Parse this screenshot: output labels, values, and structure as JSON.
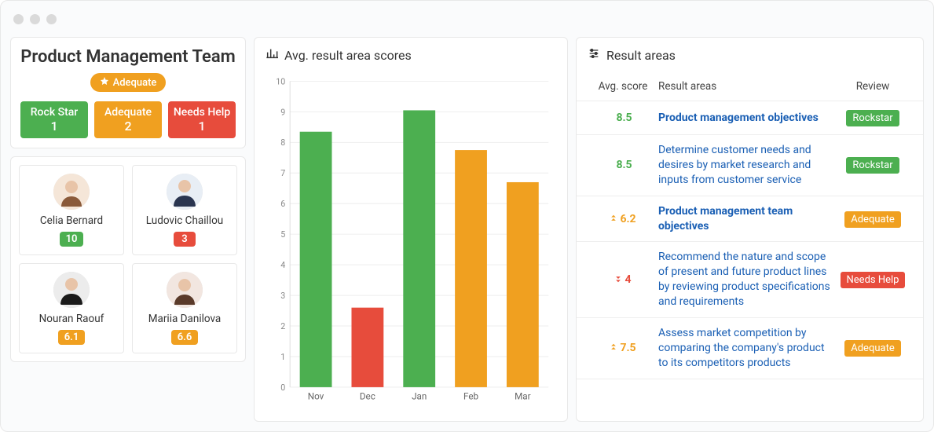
{
  "team": {
    "title": "Product Management Team",
    "badge_label": "Adequate",
    "badge_color": "#f0a020",
    "statuses": [
      {
        "label": "Rock Star",
        "count": "1",
        "color": "#4caf50"
      },
      {
        "label": "Adequate",
        "count": "2",
        "color": "#f0a020"
      },
      {
        "label": "Needs Help",
        "count": "1",
        "color": "#e74c3c"
      }
    ],
    "members": [
      {
        "name": "Celia Bernard",
        "score": "10",
        "score_color": "#4caf50"
      },
      {
        "name": "Ludovic Chaillou",
        "score": "3",
        "score_color": "#e74c3c"
      },
      {
        "name": "Nouran Raouf",
        "score": "6.1",
        "score_color": "#f0a020"
      },
      {
        "name": "Mariia Danilova",
        "score": "6.6",
        "score_color": "#f0a020"
      }
    ]
  },
  "chart_title": "Avg. result area scores",
  "chart_data": {
    "type": "bar",
    "title": "Avg. result area scores",
    "categories": [
      "Nov",
      "Dec",
      "Jan",
      "Feb",
      "Mar"
    ],
    "values": [
      8.35,
      2.6,
      9.05,
      7.75,
      6.7
    ],
    "colors": [
      "#4caf50",
      "#e74c3c",
      "#4caf50",
      "#f0a020",
      "#f0a020"
    ],
    "xlabel": "",
    "ylabel": "",
    "ylim": [
      0,
      10
    ],
    "yticks": [
      0,
      1,
      2,
      3,
      4,
      5,
      6,
      7,
      8,
      9,
      10
    ]
  },
  "result_areas": {
    "title": "Result areas",
    "columns": {
      "score": "Avg. score",
      "area": "Result areas",
      "review": "Review"
    },
    "rows": [
      {
        "score": "8.5",
        "score_color": "#4caf50",
        "trend": "none",
        "area": "Product management objectives",
        "bold": true,
        "review": "Rockstar",
        "review_color": "#4caf50"
      },
      {
        "score": "8.5",
        "score_color": "#4caf50",
        "trend": "none",
        "area": "Determine customer needs and desires by market research and inputs from customer service",
        "bold": false,
        "review": "Rockstar",
        "review_color": "#4caf50"
      },
      {
        "score": "6.2",
        "score_color": "#f0a020",
        "trend": "up",
        "area": "Product management team objectives",
        "bold": true,
        "review": "Adequate",
        "review_color": "#f0a020"
      },
      {
        "score": "4",
        "score_color": "#e74c3c",
        "trend": "down",
        "area": "Recommend the nature and scope of present and future product lines by reviewing product specifications and requirements",
        "bold": false,
        "review": "Needs Help",
        "review_color": "#e74c3c"
      },
      {
        "score": "7.5",
        "score_color": "#f0a020",
        "trend": "up",
        "area": "Assess market competition by comparing the company's product to its competitors products",
        "bold": false,
        "review": "Adequate",
        "review_color": "#f0a020"
      }
    ]
  }
}
